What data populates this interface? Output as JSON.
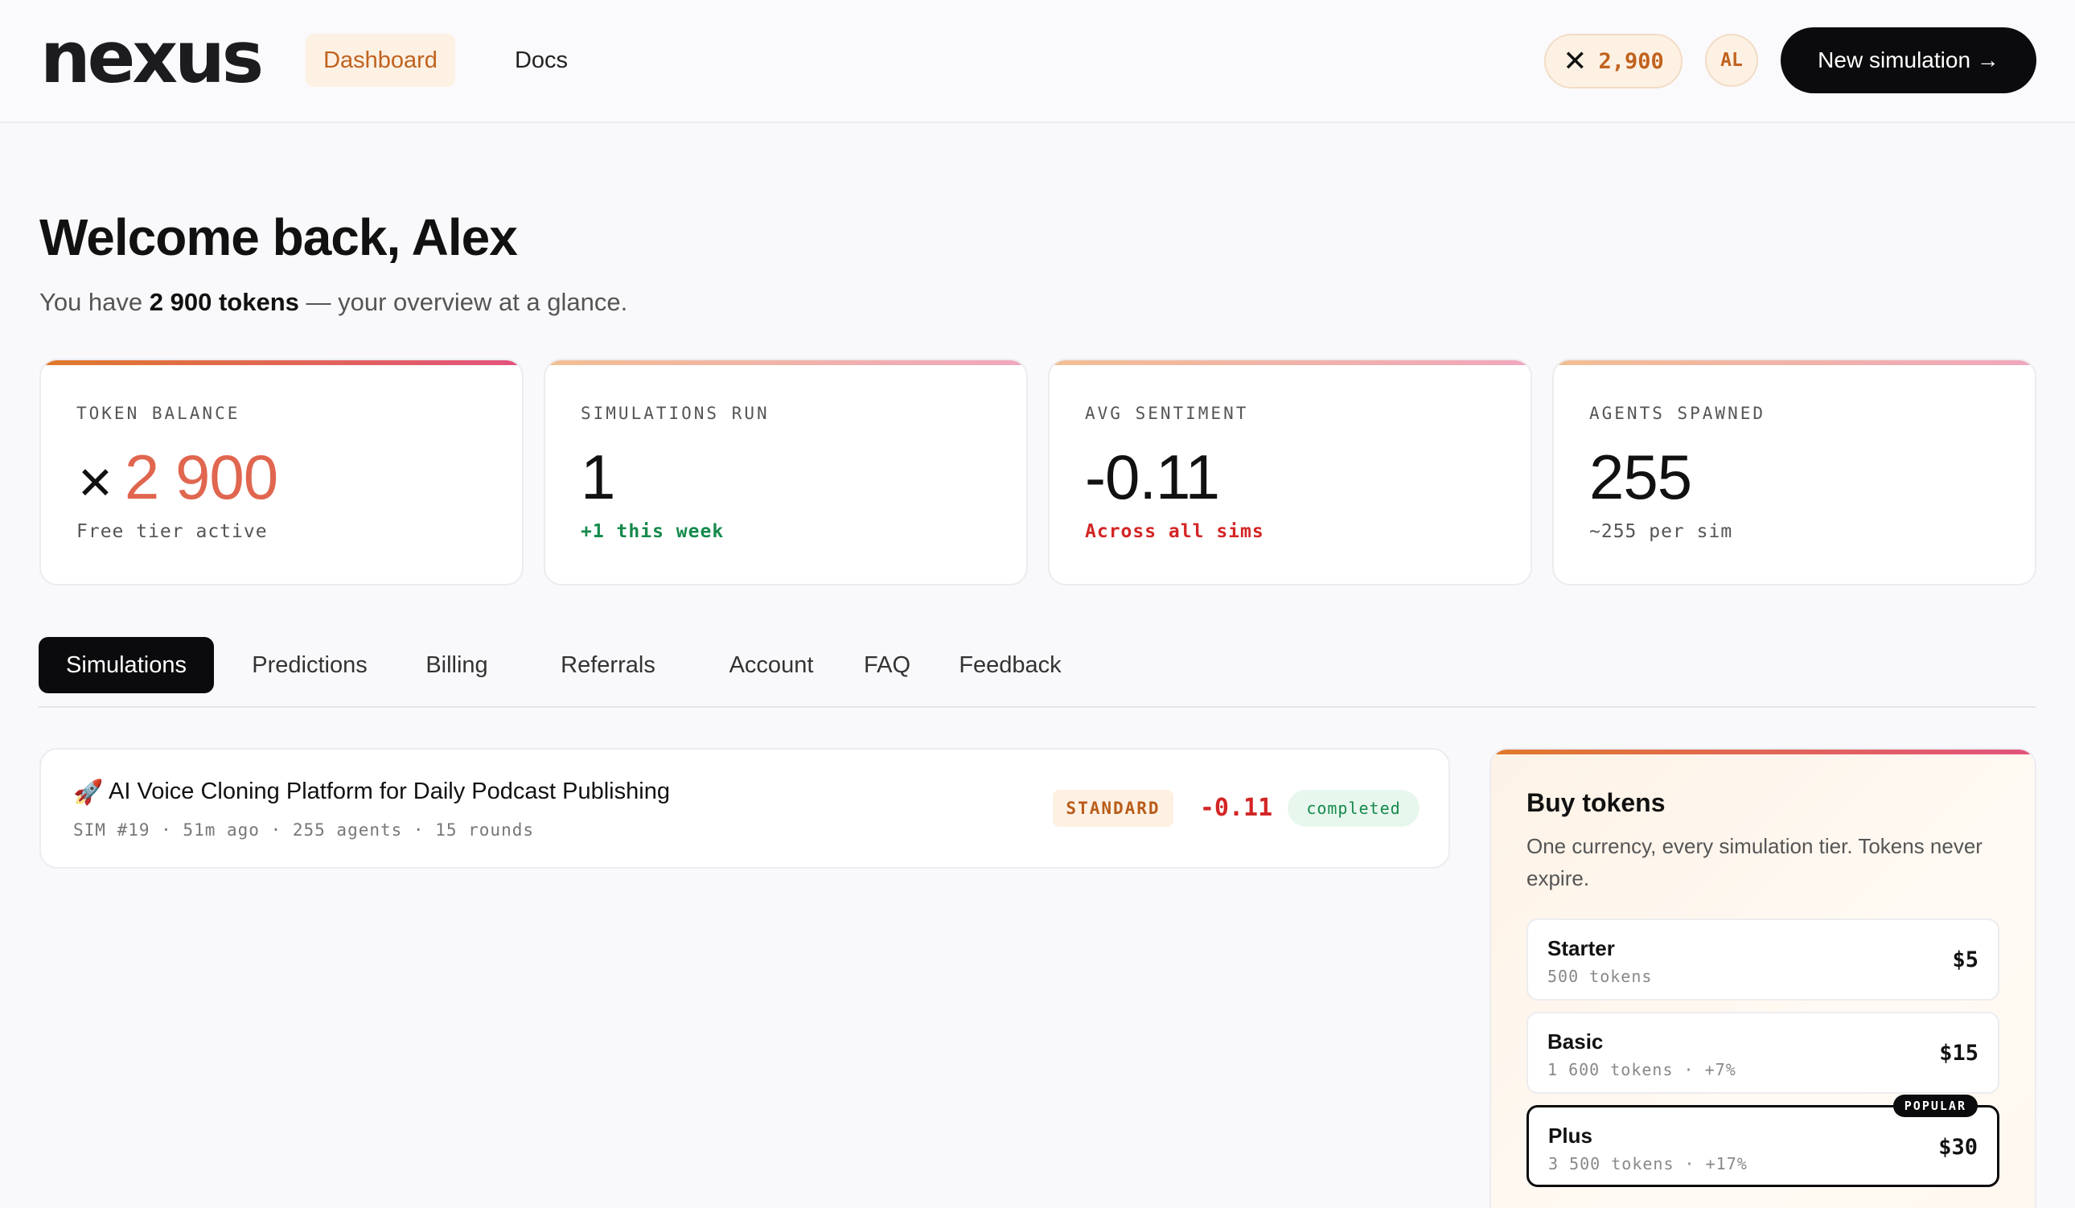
{
  "header": {
    "logo_text": "nexus",
    "nav": {
      "dashboard": "Dashboard",
      "docs": "Docs"
    },
    "token_balance": "2,900",
    "avatar_initials": "AL",
    "new_simulation": "New simulation →"
  },
  "welcome": {
    "title": "Welcome back, Alex",
    "sub_prefix": "You have ",
    "sub_tokens": "2 900 tokens",
    "sub_suffix": " — your overview at a glance."
  },
  "stats": [
    {
      "label": "TOKEN BALANCE",
      "value": "2 900",
      "note": "Free tier active"
    },
    {
      "label": "SIMULATIONS RUN",
      "value": "1",
      "note": "+1 this week"
    },
    {
      "label": "AVG SENTIMENT",
      "value": "-0.11",
      "note": "Across all sims"
    },
    {
      "label": "AGENTS SPAWNED",
      "value": "255",
      "note": "~255 per sim"
    }
  ],
  "tabs": [
    "Simulations",
    "Predictions",
    "Billing",
    "Referrals",
    "Account",
    "FAQ",
    "Feedback"
  ],
  "simulations": [
    {
      "icon": "🚀",
      "title": "AI Voice Cloning Platform for Daily Podcast Publishing",
      "meta": "SIM #19 · 51m ago · 255 agents · 15 rounds",
      "tier": "STANDARD",
      "score": "-0.11",
      "status": "completed"
    }
  ],
  "buy": {
    "title": "Buy tokens",
    "description": "One currency, every simulation tier. Tokens never expire.",
    "plans": [
      {
        "name": "Starter",
        "tokens": "500 tokens",
        "price": "$5"
      },
      {
        "name": "Basic",
        "tokens": "1 600 tokens · +7%",
        "price": "$15"
      },
      {
        "name": "Plus",
        "tokens": "3 500 tokens · +17%",
        "price": "$30",
        "badge": "POPULAR"
      }
    ]
  },
  "colors": {
    "accent": "#c0621e",
    "accent_bg": "#fdf1e4",
    "gradient_start": "#e0792b",
    "gradient_end": "#e2537d",
    "positive": "#148a4c",
    "negative": "#d32525",
    "dark": "#0b0b0d"
  }
}
